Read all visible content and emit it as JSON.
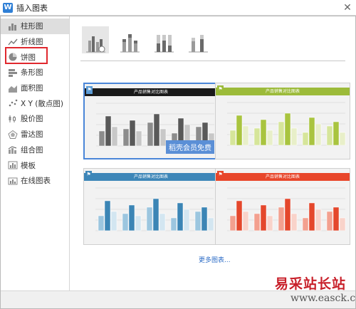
{
  "window": {
    "title": "插入图表",
    "app_icon": "W",
    "close_glyph": "✕"
  },
  "sidebar": {
    "items": [
      {
        "label": "柱形图",
        "icon": "column-chart-icon",
        "active": true
      },
      {
        "label": "折线图",
        "icon": "line-chart-icon"
      },
      {
        "label": "饼图",
        "icon": "pie-chart-icon",
        "highlighted": true
      },
      {
        "label": "条形图",
        "icon": "bar-chart-icon"
      },
      {
        "label": "面积图",
        "icon": "area-chart-icon"
      },
      {
        "label": "X Y (散点图)",
        "icon": "scatter-chart-icon"
      },
      {
        "label": "股价图",
        "icon": "stock-chart-icon"
      },
      {
        "label": "雷达图",
        "icon": "radar-chart-icon"
      },
      {
        "label": "组合图",
        "icon": "combo-chart-icon"
      },
      {
        "label": "模板",
        "icon": "template-icon"
      },
      {
        "label": "在线图表",
        "icon": "online-chart-icon"
      }
    ]
  },
  "subtypes": [
    {
      "icon": "clustered-column-icon",
      "selected": true
    },
    {
      "icon": "stacked-column-icon"
    },
    {
      "icon": "percent-stacked-column-icon"
    },
    {
      "icon": "3d-column-icon"
    }
  ],
  "templates": [
    {
      "title": "产品销售对比图表",
      "header_color": "#1a1a1a",
      "palette": [
        "#8c8c8c",
        "#595959",
        "#c8c8c8"
      ],
      "badge": "稻壳会员免费"
    },
    {
      "title": "产品销售对比图表",
      "header_color": "#9cbb3a",
      "palette": [
        "#d6e59a",
        "#a9c43f",
        "#e8efc9"
      ]
    },
    {
      "title": "产品销售对比图表",
      "header_color": "#3d86b8",
      "palette": [
        "#9cc6df",
        "#3b85b5",
        "#d3e6f1"
      ]
    },
    {
      "title": "产品销售对比图表",
      "header_color": "#e8462a",
      "palette": [
        "#f3a08f",
        "#e4472c",
        "#f9d3ca"
      ]
    }
  ],
  "more_link": "更多图表...",
  "watermark": {
    "main": "易采站长站",
    "sub": "www.easck.com"
  }
}
